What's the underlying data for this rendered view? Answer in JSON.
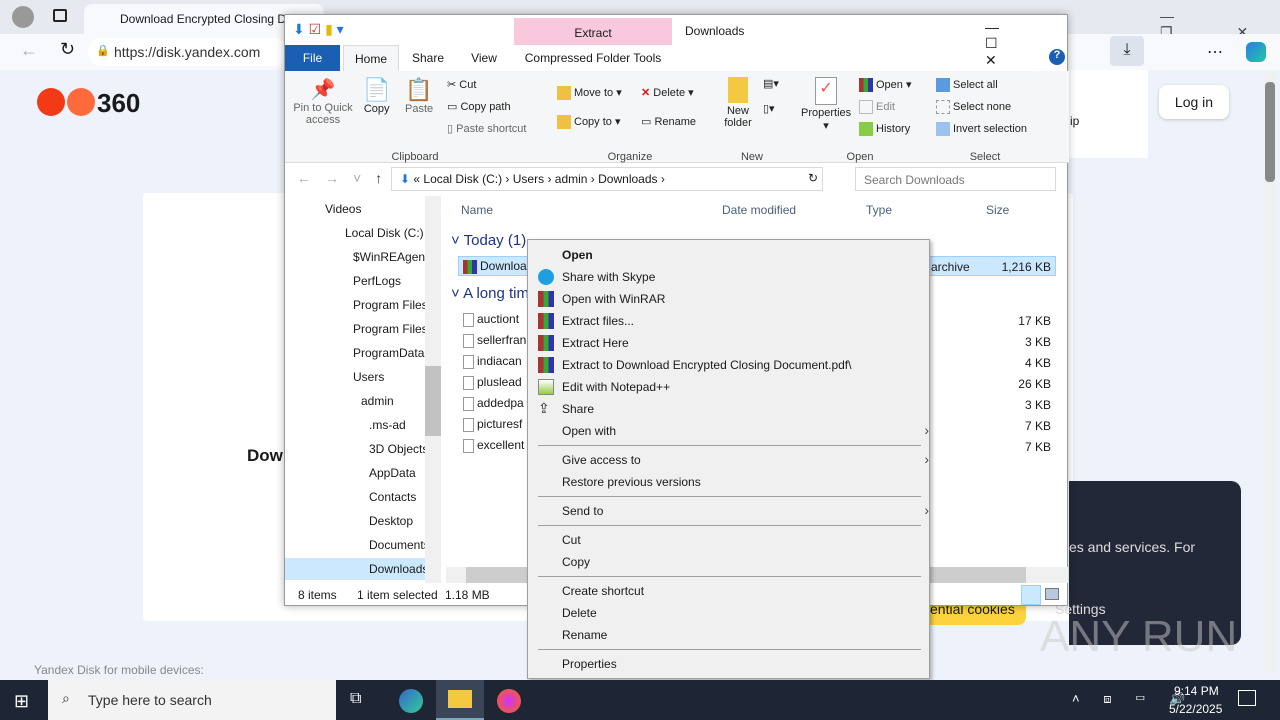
{
  "browser": {
    "tab_title": "Download Encrypted Closing D",
    "url": "https://disk.yandex.com",
    "login": "Log in",
    "right_snippet": "ip"
  },
  "page": {
    "logo": "360",
    "heading": "Dow",
    "footer": "Yandex Disk for mobile devices:",
    "cookie_text": "es and services. For",
    "cookie_accept": "ential cookies",
    "cookie_settings": "Settings",
    "watermark": "ANY RUN"
  },
  "explorer": {
    "title": "Downloads",
    "context_tab": "Extract",
    "tabs": {
      "file": "File",
      "home": "Home",
      "share": "Share",
      "view": "View",
      "tools": "Compressed Folder Tools"
    },
    "ribbon": {
      "pin": "Pin to Quick access",
      "copy": "Copy",
      "paste": "Paste",
      "cut": "Cut",
      "copy_path": "Copy path",
      "paste_shortcut": "Paste shortcut",
      "clipboard": "Clipboard",
      "move_to": "Move to",
      "copy_to": "Copy to",
      "delete": "Delete",
      "rename": "Rename",
      "organize": "Organize",
      "new_folder": "New folder",
      "new": "New",
      "properties": "Properties",
      "open": "Open",
      "edit": "Edit",
      "history": "History",
      "open_group": "Open",
      "select_all": "Select all",
      "select_none": "Select none",
      "invert": "Invert selection",
      "select": "Select"
    },
    "path": [
      "Local Disk (C:)",
      "Users",
      "admin",
      "Downloads"
    ],
    "search_placeholder": "Search Downloads",
    "nav": [
      "Videos",
      "Local Disk (C:)",
      "$WinREAgent",
      "PerfLogs",
      "Program Files",
      "Program Files",
      "ProgramData",
      "Users",
      "admin",
      ".ms-ad",
      "3D Objects",
      "AppData",
      "Contacts",
      "Desktop",
      "Documents",
      "Downloads"
    ],
    "columns": {
      "name": "Name",
      "date": "Date modified",
      "type": "Type",
      "size": "Size"
    },
    "groups": {
      "today": "Today (1)",
      "long": "A long time ago"
    },
    "selected_file": {
      "name": "Downloa",
      "type": "archive",
      "size": "1,216 KB"
    },
    "files": [
      {
        "name": "auctiont",
        "size": "17 KB"
      },
      {
        "name": "sellerfran",
        "size": "3 KB"
      },
      {
        "name": "indiacan",
        "size": "4 KB"
      },
      {
        "name": "pluslead",
        "size": "26 KB"
      },
      {
        "name": "addedpa",
        "size": "3 KB"
      },
      {
        "name": "picturesf",
        "size": "7 KB"
      },
      {
        "name": "excellent",
        "size": "7 KB"
      }
    ],
    "status": {
      "items": "8 items",
      "selected": "1 item selected",
      "size": "1.18 MB"
    }
  },
  "menu": {
    "open": "Open",
    "skype": "Share with Skype",
    "winrar": "Open with WinRAR",
    "extract_files": "Extract files...",
    "extract_here": "Extract Here",
    "extract_to": "Extract to Download Encrypted Closing Document.pdf\\",
    "notepad": "Edit with Notepad++",
    "share": "Share",
    "open_with": "Open with",
    "give_access": "Give access to",
    "restore": "Restore previous versions",
    "send_to": "Send to",
    "cut": "Cut",
    "copy": "Copy",
    "create_shortcut": "Create shortcut",
    "delete": "Delete",
    "rename": "Rename",
    "properties": "Properties"
  },
  "taskbar": {
    "search": "Type here to search",
    "time": "9:14 PM",
    "date": "5/22/2025"
  }
}
